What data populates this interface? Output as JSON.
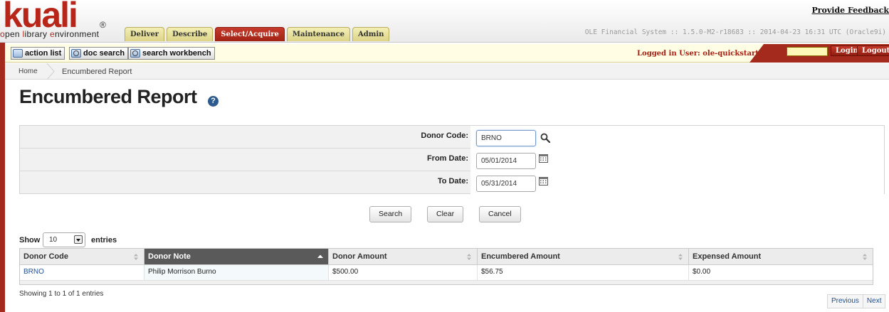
{
  "header": {
    "logo_text": "kuali",
    "logo_tagline_o": "o",
    "logo_tagline_rest1": "pen ",
    "logo_tagline_l": "l",
    "logo_tagline_rest2": "ibrary ",
    "logo_tagline_e": "e",
    "logo_tagline_rest3": "nvironment",
    "feedback_link": "Provide Feedback",
    "system_info": "OLE Financial System :: 1.5.0-M2-r18683 :: 2014-04-23 16:31 UTC (Oracle9i)",
    "tabs": [
      {
        "label": "Deliver"
      },
      {
        "label": "Describe"
      },
      {
        "label": "Select/Acquire"
      },
      {
        "label": "Maintenance"
      },
      {
        "label": "Admin"
      }
    ]
  },
  "toolbar": {
    "action_list": "action list",
    "doc_search": "doc search",
    "search_workbench": "search workbench",
    "logged_in": "Logged in User: ole-quickstart",
    "login_value": "",
    "login_button": "Login",
    "logout_button": "Logout"
  },
  "breadcrumb": {
    "home": "Home",
    "current": "Encumbered Report"
  },
  "page_title": "Encumbered Report",
  "help_glyph": "?",
  "criteria": {
    "donor_code_label": "Donor Code:",
    "donor_code_value": "BRNO",
    "from_date_label": "From Date:",
    "from_date_value": "05/01/2014",
    "to_date_label": "To Date:",
    "to_date_value": "05/31/2014"
  },
  "buttons": {
    "search": "Search",
    "clear": "Clear",
    "cancel": "Cancel"
  },
  "table_controls": {
    "show": "Show",
    "page_size": "10",
    "entries": "entries"
  },
  "table": {
    "columns": [
      {
        "label": "Donor Code"
      },
      {
        "label": "Donor Note"
      },
      {
        "label": "Donor Amount"
      },
      {
        "label": "Encumbered Amount"
      },
      {
        "label": "Expensed Amount"
      }
    ],
    "rows": [
      {
        "donor_code": "BRNO",
        "donor_note": "Philip Morrison Burno",
        "donor_amount": "$500.00",
        "encumbered_amount": "$56.75",
        "expensed_amount": "$0.00"
      }
    ]
  },
  "footer": {
    "info": "Showing 1 to 1 of 1 entries",
    "previous": "Previous",
    "next": "Next"
  },
  "colors": {
    "brand_red": "#a32a1c",
    "tab_yellow": "#ddd489",
    "link_blue": "#1f4f8f"
  }
}
